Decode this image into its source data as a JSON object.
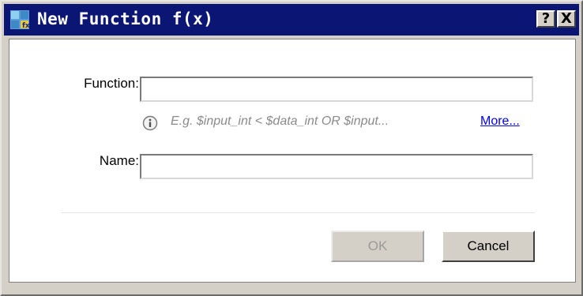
{
  "window": {
    "title": "New Function f(x)",
    "help_label": "?",
    "close_label": "X",
    "app_icon": "function-app-icon"
  },
  "form": {
    "function_label": "Function:",
    "function_value": "",
    "name_label": "Name:",
    "name_value": "",
    "hint_icon": "info-icon",
    "hint_text": "E.g. $input_int < $data_int OR $input...",
    "more_link": "More..."
  },
  "buttons": {
    "ok_label": "OK",
    "ok_enabled": false,
    "cancel_label": "Cancel"
  },
  "colors": {
    "titlebar": "#0a1574",
    "link": "#0000ee"
  }
}
